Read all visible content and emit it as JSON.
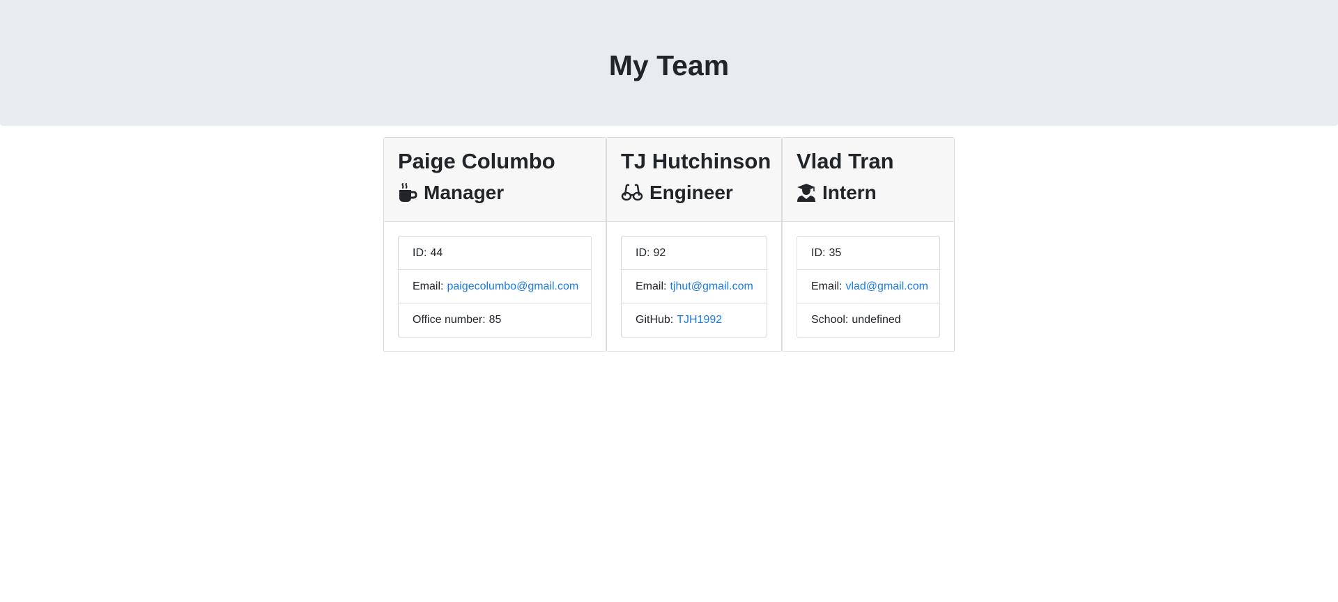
{
  "header": {
    "title": "My Team"
  },
  "team": [
    {
      "name": "Paige Columbo",
      "role": "Manager",
      "icon": "coffee-icon",
      "id_label": "ID:",
      "id": "44",
      "email_label": "Email:",
      "email": "paigecolumbo@gmail.com",
      "extra_label": "Office number:",
      "extra": "85"
    },
    {
      "name": "TJ Hutchinson",
      "role": "Engineer",
      "icon": "glasses-icon",
      "id_label": "ID:",
      "id": "92",
      "email_label": "Email:",
      "email": "tjhut@gmail.com",
      "extra_label": "GitHub:",
      "extra": "TJH1992"
    },
    {
      "name": "Vlad Tran",
      "role": "Intern",
      "icon": "graduate-icon",
      "id_label": "ID:",
      "id": "35",
      "email_label": "Email:",
      "email": "vlad@gmail.com",
      "extra_label": "School:",
      "extra": "undefined"
    }
  ],
  "colors": {
    "header_bg": "#e9ecef",
    "card_header_bg": "#f7f7f7",
    "link": "#1b7be3",
    "text": "#212529"
  }
}
